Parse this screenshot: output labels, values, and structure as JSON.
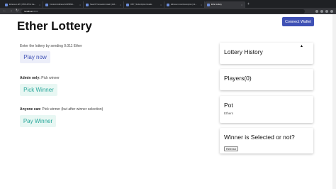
{
  "browser": {
    "tabs": [
      {
        "label": "Ethereum API | IPFS API & Ga...",
        "active": false
      },
      {
        "label": "Contract Address 0x0b5f83d...",
        "active": false
      },
      {
        "label": "Search Transaction Hash | Eth...",
        "active": false
      },
      {
        "label": "OBY | Subscription Details",
        "active": false
      },
      {
        "label": "Ethereum cost Exemption | Et...",
        "active": false
      },
      {
        "label": "Ether Lottery",
        "active": true
      }
    ],
    "new_tab": "+",
    "back": "←",
    "forward": "→",
    "reload": "↻",
    "url_host": "localhost",
    "url_port": ":3000"
  },
  "page": {
    "title": "Ether Lottery",
    "connect_label": "Connect Wallet",
    "enter_text": "Enter the lottery by sending 0.011 Ether",
    "play_label": "Play now",
    "admin_bold": "Admin only:",
    "admin_text": " Pick winner",
    "pick_label": "Pick Winner",
    "anyone_bold": "Anyone can:",
    "anyone_text": " Pick winner (but after winner selection)",
    "pay_label": "Pay Winner"
  },
  "cards": {
    "history_title": "Lottery History",
    "players_title": "Players(0)",
    "pot_title": "Pot",
    "pot_sub": "Ethers",
    "winner_title": "Winner is Selected or not?",
    "refresh_label": "Refresh"
  },
  "colors": {
    "accent": "#3f51b5",
    "teal": "#26a69a"
  }
}
